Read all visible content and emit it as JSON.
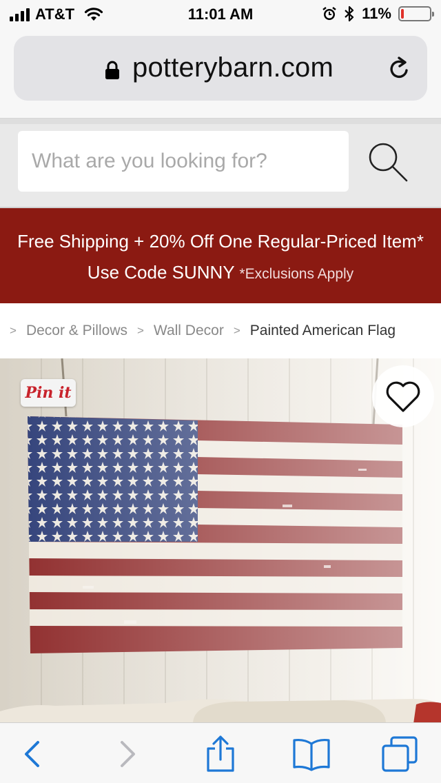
{
  "status_bar": {
    "carrier": "AT&T",
    "time": "11:01 AM",
    "battery_percent": "11%",
    "battery_level": 0.11,
    "battery_color": "#e0312a"
  },
  "browser": {
    "url": "potterybarn.com",
    "icons": {
      "lock": "lock-icon",
      "reload": "reload-icon"
    }
  },
  "search": {
    "placeholder": "What are you looking for?",
    "value": "",
    "icon": "search-icon"
  },
  "promo": {
    "line1": "Free Shipping + 20% Off One Regular-Priced Item*",
    "line2": "Use Code SUNNY",
    "note": "*Exclusions Apply",
    "background_color": "#8b1a12"
  },
  "breadcrumb": {
    "separator": ">",
    "items": [
      "Decor & Pillows",
      "Wall Decor"
    ],
    "current": "Painted American Flag"
  },
  "product": {
    "pin_label": "Pin it",
    "favorite_icon": "heart-icon"
  },
  "toolbar": {
    "icons": [
      "back-icon",
      "forward-icon",
      "share-icon",
      "bookmarks-icon",
      "tabs-icon"
    ],
    "accent_color": "#1e78d6"
  }
}
